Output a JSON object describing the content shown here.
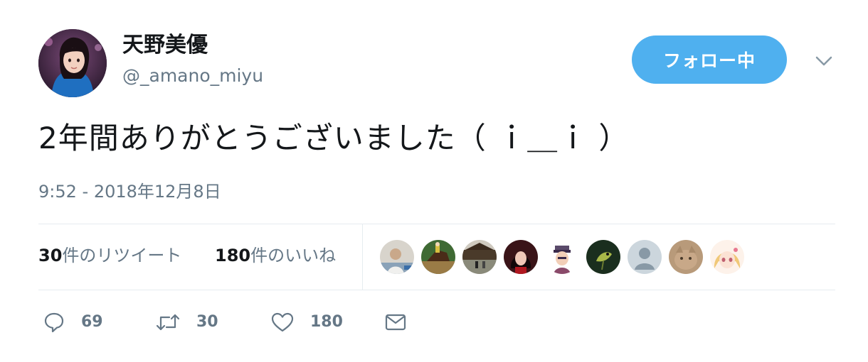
{
  "tweet": {
    "author": {
      "display_name": "天野美優",
      "handle": "@_amano_miyu",
      "avatar_icon": "user-avatar-photo"
    },
    "follow_button_label": "フォロー中",
    "menu_icon": "chevron-down-icon",
    "text": "2年間ありがとうございました（ ｉ＿ｉ ）",
    "timestamp": "9:52 - 2018年12月8日",
    "stats": {
      "retweets_count": "30",
      "retweets_label": "件のリツイート",
      "likes_count": "180",
      "likes_label": "件のいいね"
    },
    "liker_avatars": [
      {
        "name": "liker-avatar-1"
      },
      {
        "name": "liker-avatar-2"
      },
      {
        "name": "liker-avatar-3"
      },
      {
        "name": "liker-avatar-4"
      },
      {
        "name": "liker-avatar-5"
      },
      {
        "name": "liker-avatar-6"
      },
      {
        "name": "liker-avatar-7-default"
      },
      {
        "name": "liker-avatar-8"
      },
      {
        "name": "liker-avatar-9"
      }
    ],
    "actions": {
      "reply_count": "69",
      "retweet_count": "30",
      "like_count": "180",
      "reply_icon": "reply-icon",
      "retweet_icon": "retweet-icon",
      "like_icon": "heart-icon",
      "dm_icon": "envelope-icon"
    }
  },
  "colors": {
    "accent": "#4fb0ef",
    "text_primary": "#14171a",
    "text_secondary": "#657786",
    "divider": "#e6ecf0"
  }
}
